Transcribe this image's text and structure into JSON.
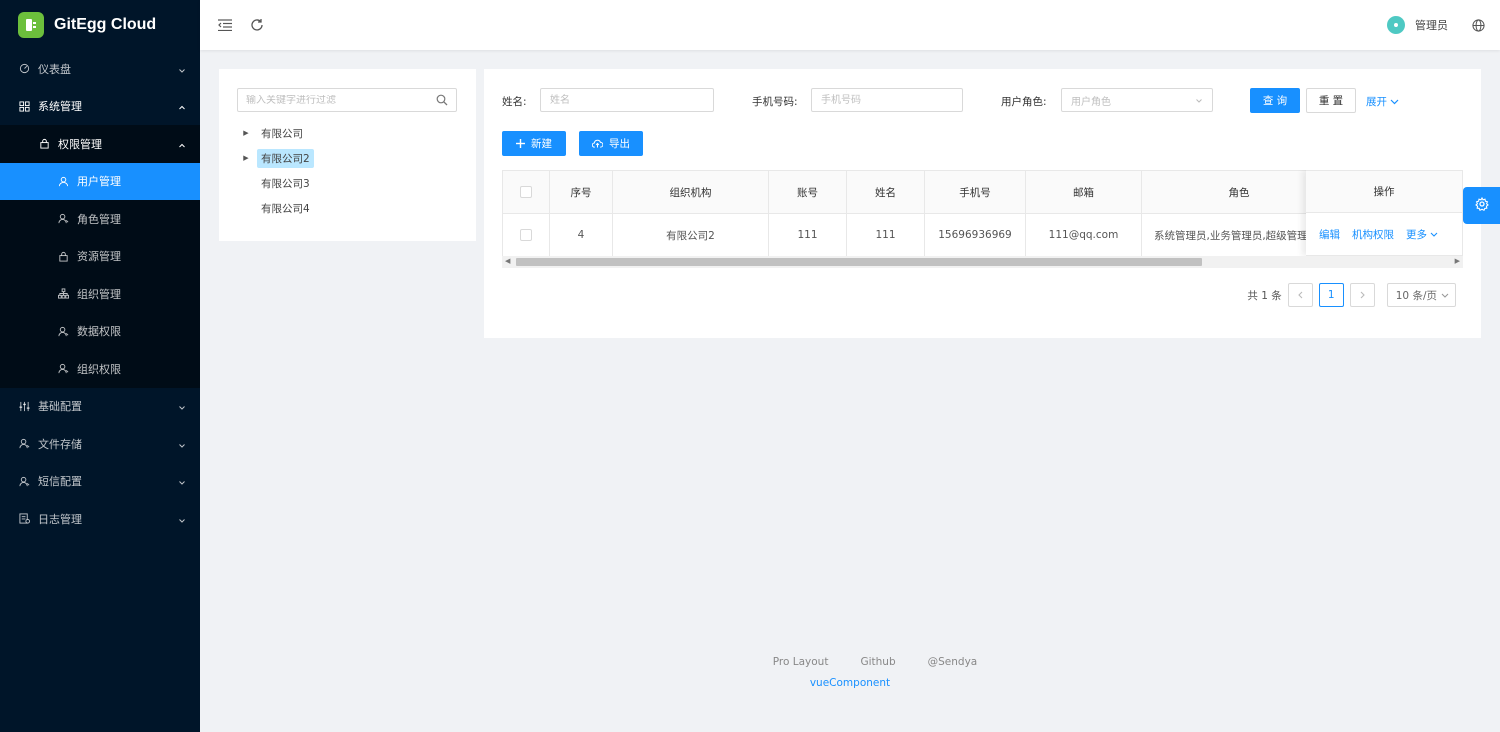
{
  "app": {
    "title": "GitEgg Cloud",
    "brand_color": "#1890ff",
    "sidebar_color": "#001529"
  },
  "sidebar": {
    "items": [
      {
        "label": "仪表盘",
        "icon": "dashboard-icon",
        "level": 1,
        "state": "collapsed"
      },
      {
        "label": "系统管理",
        "icon": "system-icon",
        "level": 1,
        "state": "open"
      },
      {
        "label": "权限管理",
        "icon": "lock-icon",
        "level": 2,
        "state": "open"
      },
      {
        "label": "用户管理",
        "icon": "user-icon",
        "level": 3,
        "state": "active"
      },
      {
        "label": "角色管理",
        "icon": "user-role-icon",
        "level": 3
      },
      {
        "label": "资源管理",
        "icon": "lock-icon",
        "level": 3
      },
      {
        "label": "组织管理",
        "icon": "org-icon",
        "level": 3
      },
      {
        "label": "数据权限",
        "icon": "user-data-icon",
        "level": 3
      },
      {
        "label": "组织权限",
        "icon": "user-org-icon",
        "level": 3
      },
      {
        "label": "基础配置",
        "icon": "sliders-icon",
        "level": 1,
        "state": "collapsed"
      },
      {
        "label": "文件存储",
        "icon": "user-file-icon",
        "level": 1,
        "state": "collapsed"
      },
      {
        "label": "短信配置",
        "icon": "user-sms-icon",
        "level": 1,
        "state": "collapsed"
      },
      {
        "label": "日志管理",
        "icon": "log-icon",
        "level": 1,
        "state": "collapsed"
      }
    ]
  },
  "header": {
    "user_name": "管理员"
  },
  "tree": {
    "search_placeholder": "输入关键字进行过滤",
    "nodes": [
      {
        "label": "有限公司",
        "expandable": true,
        "selected": false
      },
      {
        "label": "有限公司2",
        "expandable": true,
        "selected": true
      },
      {
        "label": "有限公司3",
        "expandable": false,
        "selected": false
      },
      {
        "label": "有限公司4",
        "expandable": false,
        "selected": false
      }
    ]
  },
  "filters": {
    "name_label": "姓名:",
    "name_placeholder": "姓名",
    "phone_label": "手机号码:",
    "phone_placeholder": "手机号码",
    "role_label": "用户角色:",
    "role_placeholder": "用户角色",
    "query_button": "查 询",
    "reset_button": "重 置",
    "expand_link": "展开"
  },
  "toolbar": {
    "new_button": "新建",
    "export_button": "导出"
  },
  "table": {
    "columns": [
      "序号",
      "组织机构",
      "账号",
      "姓名",
      "手机号",
      "邮箱",
      "角色",
      "操作"
    ],
    "rows": [
      {
        "index": "4",
        "org": "有限公司2",
        "account": "111",
        "name": "111",
        "phone": "15696936969",
        "email": "111@qq.com",
        "role": "系统管理员,业务管理员,超级管理员",
        "actions": [
          "编辑",
          "机构权限",
          "更多"
        ]
      }
    ]
  },
  "pagination": {
    "total_text": "共 1 条",
    "current_page": "1",
    "page_size": "10 条/页"
  },
  "footer": {
    "links": [
      "Pro Layout",
      "Github",
      "@Sendya"
    ],
    "sub": "vueComponent"
  }
}
